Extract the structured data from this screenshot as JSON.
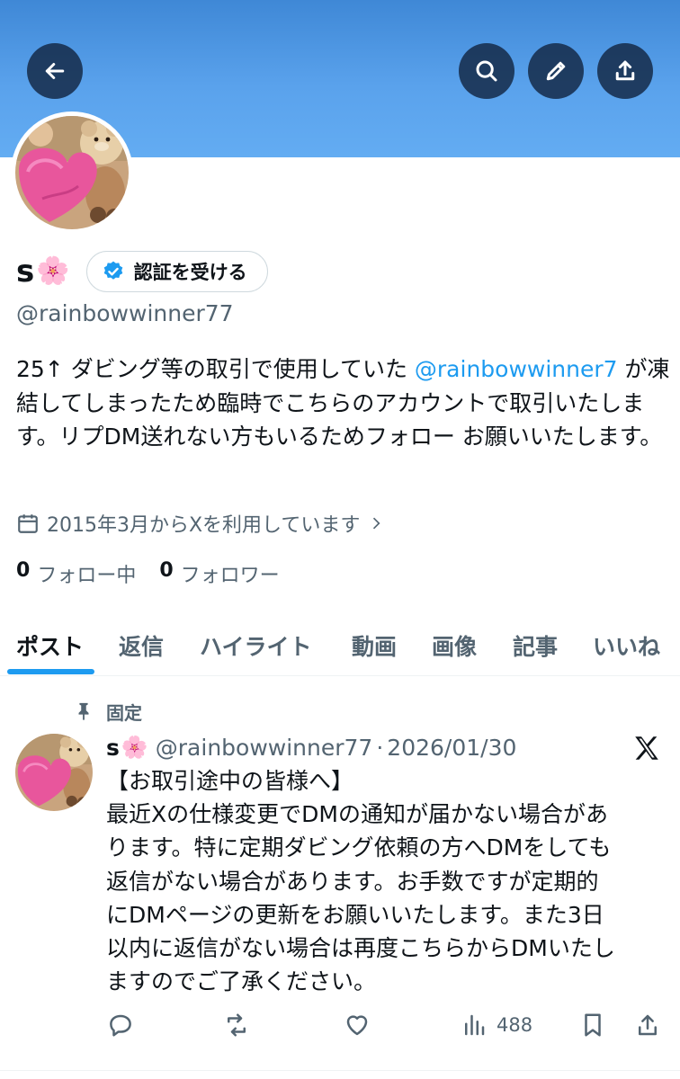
{
  "header": {
    "back_icon": "arrow-left-icon",
    "search_icon": "search-icon",
    "edit_icon": "pencil-icon",
    "share_icon": "share-icon",
    "banner_color": "#4a95e2"
  },
  "profile": {
    "display_name": "s",
    "name_emoji": "🌸",
    "verify_label": "認証を受ける",
    "handle": "@rainbowwinner77",
    "bio_before": "25↑ ダビング等の取引で使用していた ",
    "bio_mention": "@rainbowwinner7",
    "bio_after": " が凍結してしまったため臨時でこちらのアカウントで取引いたします。リプDM送れない方もいるためフォロー お願いいたします。",
    "joined": "2015年3月からXを利用しています",
    "following_count": "0",
    "following_label": "フォロー中",
    "followers_count": "0",
    "followers_label": "フォロワー"
  },
  "tabs": [
    {
      "label": "ポスト",
      "active": true
    },
    {
      "label": "返信"
    },
    {
      "label": "ハイライト"
    },
    {
      "label": "動画"
    },
    {
      "label": "画像"
    },
    {
      "label": "記事"
    },
    {
      "label": "いいね"
    }
  ],
  "post": {
    "pinned_label": "固定",
    "name": "s",
    "name_emoji": "🌸",
    "handle": "@rainbowwinner77",
    "separator": "·",
    "date": "2026/01/30",
    "lines": [
      "【お取引途中の皆様へ】",
      "最近Xの仕様変更でDMの通知が届かない場合があ",
      "ります。特に定期ダビング依頼の方へDMをしても",
      "返信がない場合があります。お手数ですが定期的",
      "にDMページの更新をお願いいたします。また3日",
      "以内に返信がない場合は再度こちらからDMいたし",
      "ますのでご了承ください。"
    ],
    "views": "488"
  },
  "colors": {
    "accent": "#1d9bf0",
    "text": "#0f1419",
    "muted": "#536471"
  }
}
